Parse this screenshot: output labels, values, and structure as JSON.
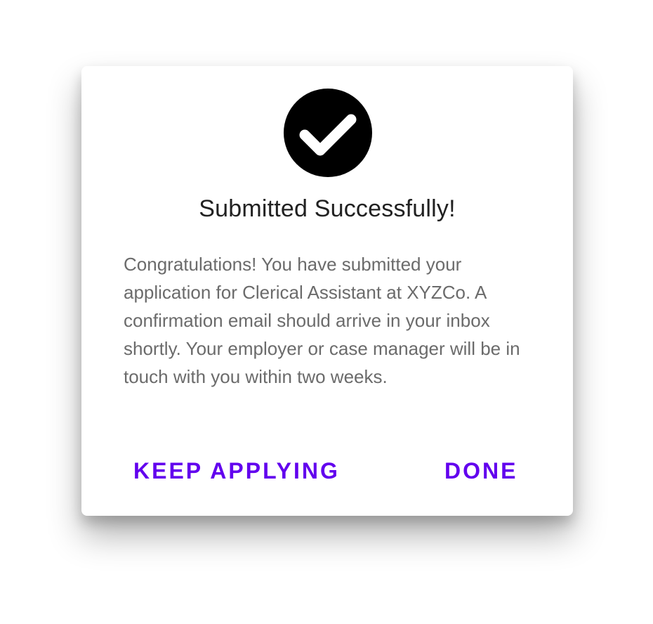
{
  "dialog": {
    "icon": "check-circle-icon",
    "title": "Submitted Successfully!",
    "message": "Congratulations! You have submitted your application for Clerical Assistant at XYZCo. A confirmation email should arrive in your inbox shortly. Your employer or case manager will be in touch with you within two weeks.",
    "actions": {
      "keep_applying_label": "KEEP APPLYING",
      "done_label": "DONE"
    }
  },
  "colors": {
    "accent": "#6200ee",
    "title_text": "#212121",
    "body_text": "#6b6b6b",
    "icon_background": "#000000",
    "icon_check": "#ffffff"
  }
}
